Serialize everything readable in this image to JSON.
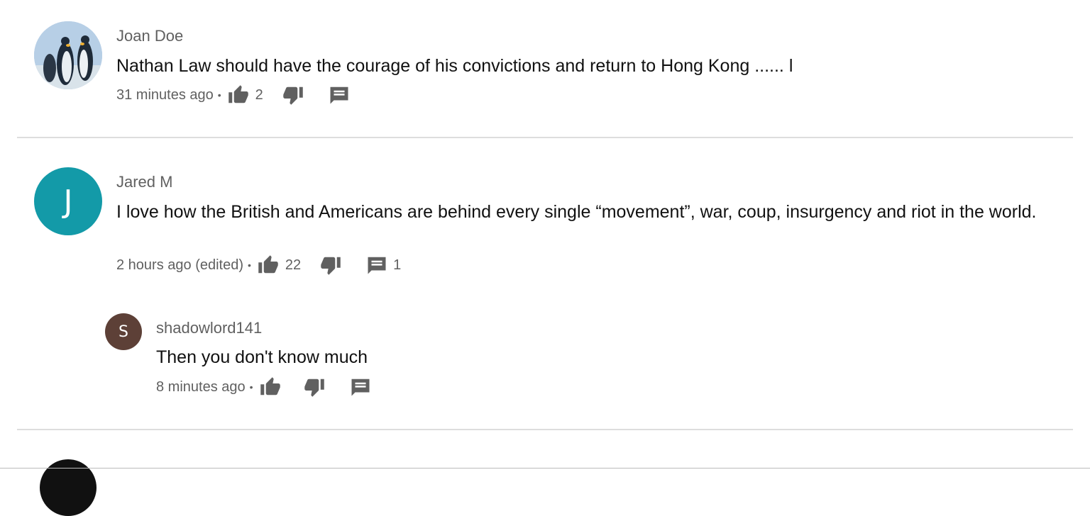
{
  "comments": [
    {
      "author": "Joan Doe",
      "avatar_icon": "penguin-photo",
      "text": "Nathan Law should have the courage of his convictions and return to Hong Kong ......   l",
      "time": "31 minutes ago",
      "likes": "2",
      "replies": ""
    },
    {
      "author": "Jared M",
      "avatar_letter": "J",
      "avatar_color": "#139aa8",
      "text": "I love how the British and Americans are behind every single “movement”, war, coup, insurgency and riot in the world.",
      "time": "2 hours ago (edited)",
      "likes": "22",
      "replies": "1"
    }
  ],
  "reply": {
    "author": "shadowlord141",
    "avatar_letter": "S",
    "avatar_color": "#5d4037",
    "text": "Then you don't know much",
    "time": "8 minutes ago"
  },
  "separator": "•"
}
